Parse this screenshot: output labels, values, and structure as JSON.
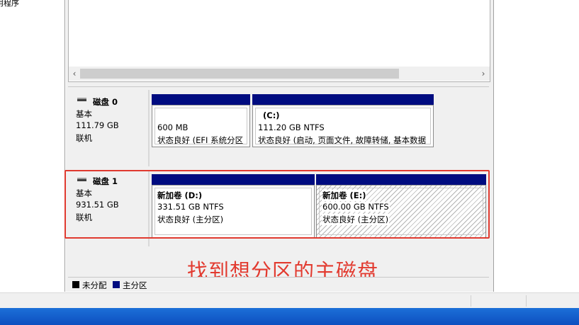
{
  "nav": {
    "partial_text": "用程序"
  },
  "disks": [
    {
      "title": "磁盘 0",
      "type": "基本",
      "size": "111.79 GB",
      "status": "联机",
      "partitions": [
        {
          "name": "",
          "size": "600 MB",
          "status": "状态良好 (EFI 系统分区"
        },
        {
          "name": "(C:)",
          "size": "111.20 GB NTFS",
          "status": "状态良好 (启动, 页面文件, 故障转储, 基本数据"
        }
      ]
    },
    {
      "title": "磁盘 1",
      "type": "基本",
      "size": "931.51 GB",
      "status": "联机",
      "partitions": [
        {
          "name": "新加卷  (D:)",
          "size": "331.51 GB NTFS",
          "status": "状态良好 (主分区)"
        },
        {
          "name": "新加卷  (E:)",
          "size": "600.00 GB NTFS",
          "status": "状态良好 (主分区)"
        }
      ]
    }
  ],
  "annotation": "找到想分区的主磁盘",
  "legend": [
    {
      "label": "未分配",
      "color": "#000000"
    },
    {
      "label": "主分区",
      "color": "#000c80"
    }
  ],
  "scroll": {
    "left_arrow": "‹",
    "right_arrow": "›"
  },
  "colors": {
    "partition_bar": "#000c80",
    "highlight": "#e03a2f",
    "annotation": "#e23a2f"
  }
}
